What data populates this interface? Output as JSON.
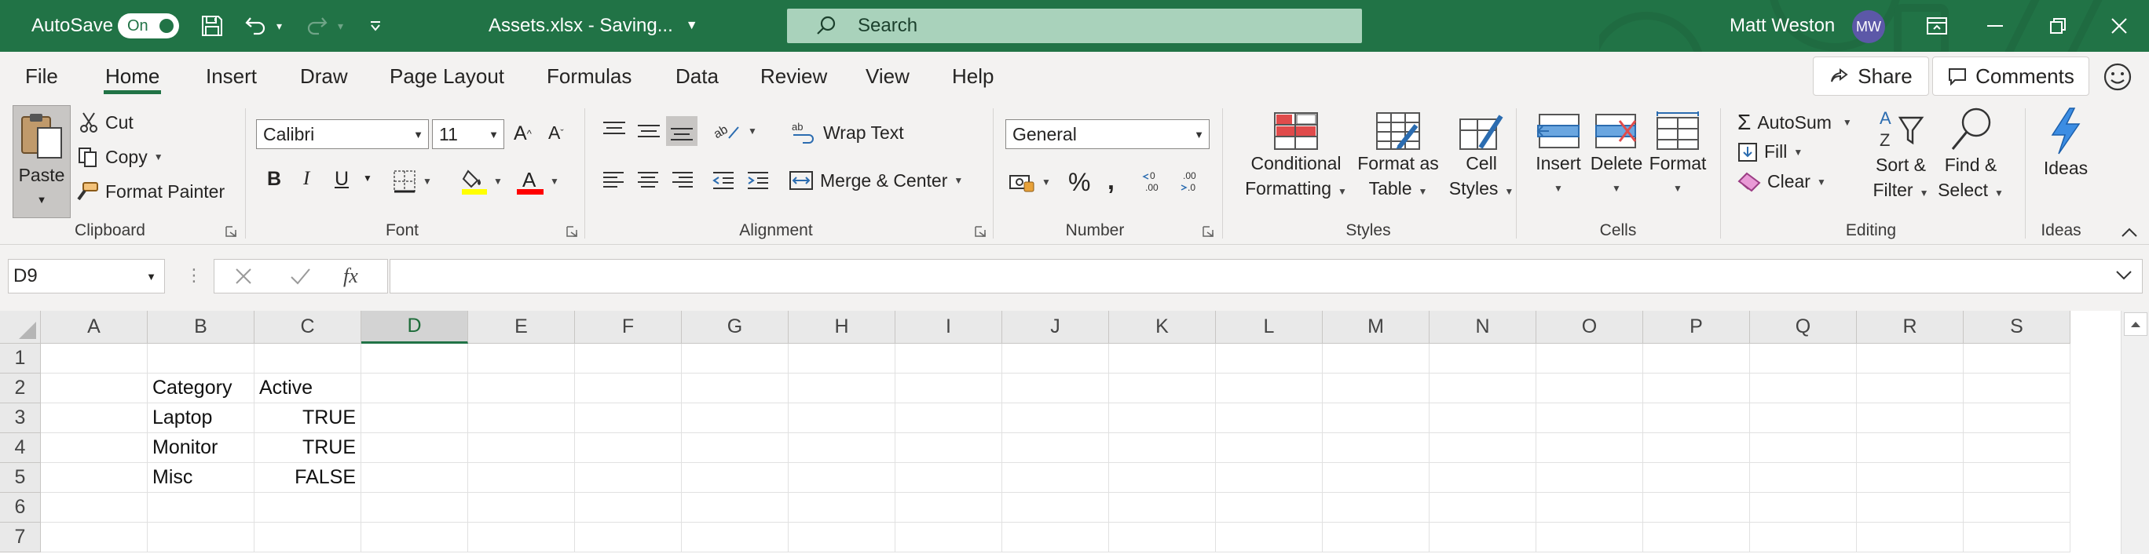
{
  "titlebar": {
    "autosave_label": "AutoSave",
    "autosave_state": "On",
    "filename": "Assets.xlsx  -  Saving...",
    "search_placeholder": "Search",
    "user_name": "Matt Weston",
    "user_initials": "MW",
    "accent_color": "#217346"
  },
  "menu": {
    "tabs": [
      "File",
      "Home",
      "Insert",
      "Draw",
      "Page Layout",
      "Formulas",
      "Data",
      "Review",
      "View",
      "Help"
    ],
    "active_tab": "Home",
    "share_label": "Share",
    "comments_label": "Comments"
  },
  "ribbon": {
    "clipboard": {
      "group": "Clipboard",
      "paste": "Paste",
      "cut": "Cut",
      "copy": "Copy",
      "format_painter": "Format Painter"
    },
    "font": {
      "group": "Font",
      "font_name": "Calibri",
      "font_size": "11",
      "bold": "B",
      "italic": "I",
      "underline": "U"
    },
    "alignment": {
      "group": "Alignment",
      "wrap_text": "Wrap Text",
      "merge_center": "Merge & Center"
    },
    "number": {
      "group": "Number",
      "format": "General"
    },
    "styles": {
      "group": "Styles",
      "conditional_1": "Conditional",
      "conditional_2": "Formatting",
      "format_table_1": "Format as",
      "format_table_2": "Table",
      "cell_styles_1": "Cell",
      "cell_styles_2": "Styles"
    },
    "cells": {
      "group": "Cells",
      "insert": "Insert",
      "delete": "Delete",
      "format": "Format"
    },
    "editing": {
      "group": "Editing",
      "autosum": "AutoSum",
      "fill": "Fill",
      "clear": "Clear",
      "sort_1": "Sort &",
      "sort_2": "Filter",
      "find_1": "Find &",
      "find_2": "Select"
    },
    "ideas": {
      "group": "Ideas",
      "label": "Ideas"
    }
  },
  "formula_bar": {
    "name_box": "D9",
    "fx": "fx",
    "formula": ""
  },
  "grid": {
    "columns": [
      "A",
      "B",
      "C",
      "D",
      "E",
      "F",
      "G",
      "H",
      "I",
      "J",
      "K",
      "L",
      "M",
      "N",
      "O",
      "P",
      "Q",
      "R",
      "S"
    ],
    "selected_column": "D",
    "rows": [
      "1",
      "2",
      "3",
      "4",
      "5",
      "6",
      "7"
    ],
    "cells": {
      "B2": "Category",
      "C2": "Active",
      "B3": "Laptop",
      "C3": "TRUE",
      "B4": "Monitor",
      "C4": "TRUE",
      "B5": "Misc",
      "C5": "FALSE"
    }
  }
}
